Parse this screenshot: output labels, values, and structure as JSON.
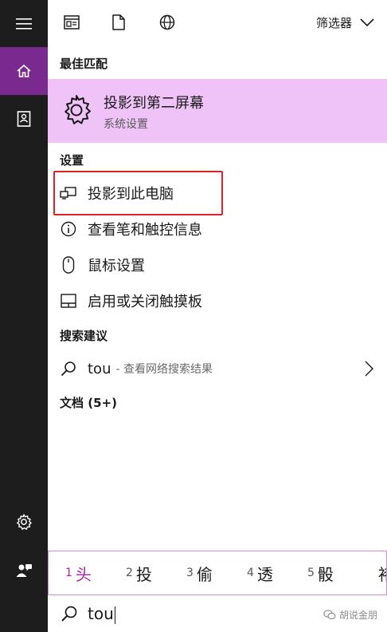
{
  "rail": {
    "items": [
      {
        "icon": "hamburger-menu-icon"
      },
      {
        "icon": "home-icon",
        "active": true
      },
      {
        "icon": "notebook-icon"
      },
      {
        "icon": "settings-gear-icon"
      },
      {
        "icon": "feedback-person-icon"
      }
    ]
  },
  "topbar": {
    "icons": [
      "app-window-icon",
      "document-icon",
      "globe-icon"
    ],
    "filter_label": "筛选器"
  },
  "sections": {
    "best_match_title": "最佳匹配",
    "settings_title": "设置",
    "suggestions_title": "搜索建议",
    "documents_title": "文档 (5+)"
  },
  "best_match": {
    "title": "投影到第二屏幕",
    "subtitle": "系统设置",
    "icon": "gear-icon"
  },
  "settings_items": [
    {
      "label": "投影到此电脑",
      "icon": "project-to-pc-icon"
    },
    {
      "label": "查看笔和触控信息",
      "icon": "info-icon"
    },
    {
      "label": "鼠标设置",
      "icon": "mouse-icon"
    },
    {
      "label": "启用或关闭触摸板",
      "icon": "touchpad-icon"
    }
  ],
  "suggestion": {
    "query": "tou",
    "description": "- 查看网络搜索结果"
  },
  "ime": {
    "candidates": [
      {
        "num": "1",
        "char": "头"
      },
      {
        "num": "2",
        "char": "投"
      },
      {
        "num": "3",
        "char": "偷"
      },
      {
        "num": "4",
        "char": "透"
      },
      {
        "num": "5",
        "char": "骰"
      },
      {
        "num": "",
        "char": "褚"
      }
    ]
  },
  "search": {
    "value": "tou"
  },
  "watermark": {
    "text": "胡说金朋"
  },
  "colors": {
    "rail_bg": "#1d1d1d",
    "rail_active": "#7a2a8e",
    "best_match_bg": "#f0c3f8",
    "highlight_border": "#e0202a",
    "ime_accent": "#b21fa8"
  }
}
